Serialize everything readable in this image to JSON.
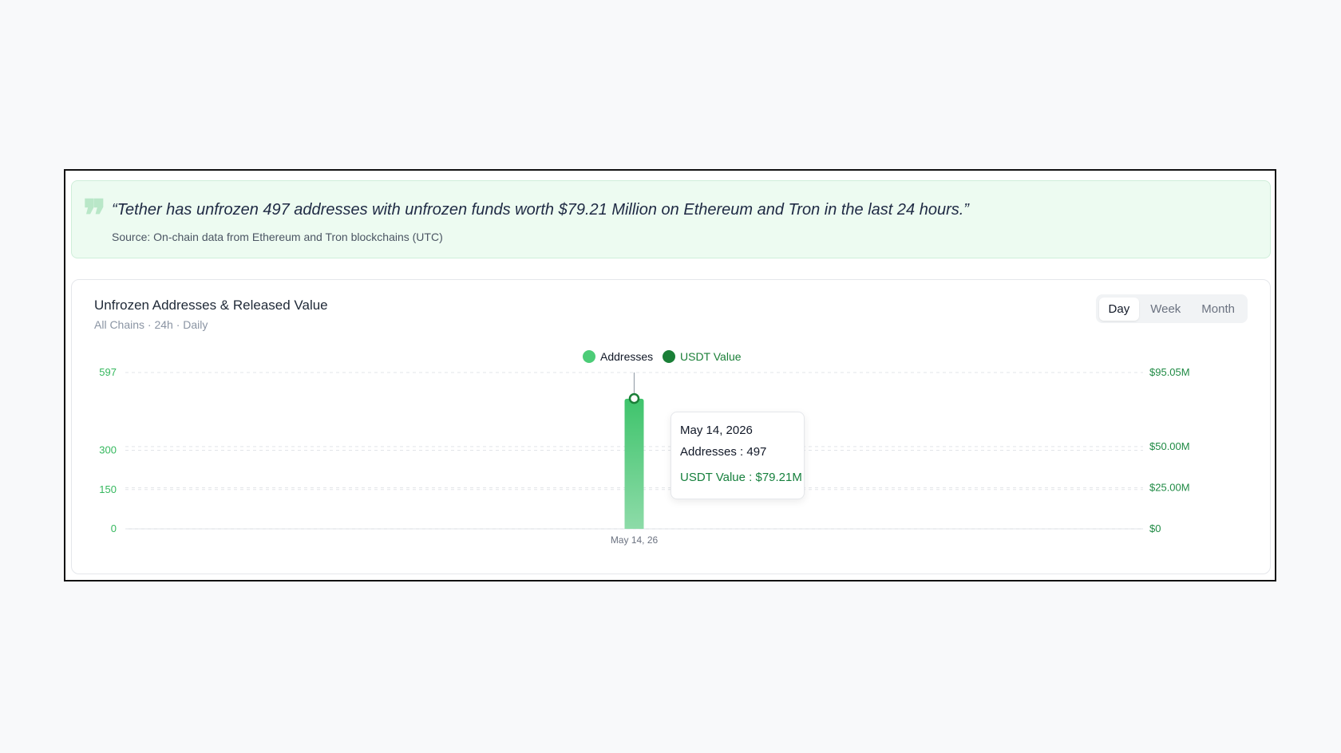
{
  "quote": {
    "icon": "quote-mark-icon",
    "text": "“Tether has unfrozen 497 addresses with unfrozen funds worth $79.21 Million on Ethereum and Tron in the last 24 hours.”",
    "source": "Source: On-chain data from Ethereum and Tron blockchains (UTC)"
  },
  "chart_header": {
    "title": "Unfrozen Addresses & Released Value",
    "subtitle": "All Chains · 24h · Daily",
    "periods": [
      {
        "label": "Day",
        "active": true
      },
      {
        "label": "Week",
        "active": false
      },
      {
        "label": "Month",
        "active": false
      }
    ]
  },
  "tooltip": {
    "date": "May 14, 2026",
    "addresses": "Addresses : 497",
    "usdt": "USDT Value : $79.21M"
  },
  "colors": {
    "addresses": "#4ccc77",
    "usdt": "#1a7f37",
    "axis_left": "#35b85e",
    "axis_right": "#1f8a44"
  },
  "chart_data": {
    "type": "bar",
    "categories": [
      "May 14, 26"
    ],
    "series": [
      {
        "name": "Addresses",
        "values": [
          497
        ],
        "axis": "left"
      },
      {
        "name": "USDT Value",
        "values": [
          79.21
        ],
        "axis": "right",
        "unit": "$M"
      }
    ],
    "y_left": {
      "ylim": [
        0,
        597
      ],
      "ticks": [
        0,
        150,
        300,
        597
      ],
      "tick_labels": [
        "0",
        "150",
        "300",
        "597"
      ]
    },
    "y_right": {
      "ylim": [
        0,
        95.05
      ],
      "ticks": [
        0,
        25,
        50,
        95.05
      ],
      "tick_labels": [
        "$0",
        "$25.00M",
        "$50.00M",
        "$95.05M"
      ]
    },
    "grid": true,
    "legend": "top-center"
  }
}
